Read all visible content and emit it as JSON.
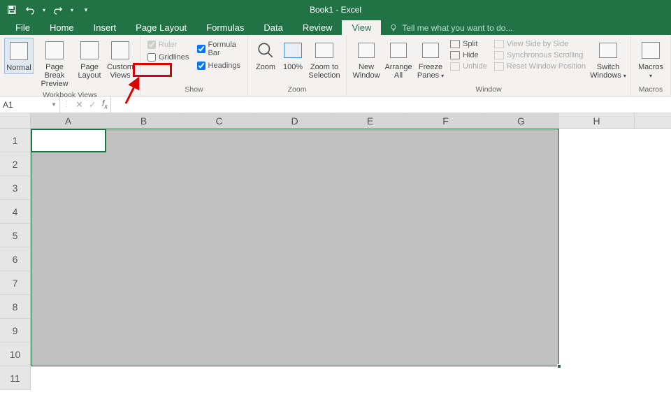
{
  "title": "Book1 - Excel",
  "menu": {
    "tabs": [
      "File",
      "Home",
      "Insert",
      "Page Layout",
      "Formulas",
      "Data",
      "Review",
      "View"
    ],
    "active": "View",
    "tellme": "Tell me what you want to do..."
  },
  "ribbon": {
    "workbook_views": {
      "normal": "Normal",
      "page_break": "Page Break Preview",
      "page_layout": "Page Layout",
      "custom_views": "Custom Views",
      "label": "Workbook Views"
    },
    "show": {
      "ruler": "Ruler",
      "gridlines": "Gridlines",
      "formula_bar": "Formula Bar",
      "headings": "Headings",
      "label": "Show"
    },
    "zoom": {
      "zoom": "Zoom",
      "hundred": "100%",
      "to_selection": "Zoom to Selection",
      "label": "Zoom"
    },
    "window": {
      "new_window": "New Window",
      "arrange_all": "Arrange All",
      "freeze_panes": "Freeze Panes",
      "split": "Split",
      "hide": "Hide",
      "unhide": "Unhide",
      "side_by_side": "View Side by Side",
      "sync_scroll": "Synchronous Scrolling",
      "reset_pos": "Reset Window Position",
      "switch_windows": "Switch Windows",
      "label": "Window"
    },
    "macros": {
      "macros": "Macros",
      "label": "Macros"
    }
  },
  "namebox": "A1",
  "columns": [
    "A",
    "B",
    "C",
    "D",
    "E",
    "F",
    "G",
    "H"
  ],
  "rows": [
    "1",
    "2",
    "3",
    "4",
    "5",
    "6",
    "7",
    "8",
    "9",
    "10",
    "11"
  ],
  "selection": {
    "from": "A1",
    "to": "G10",
    "active": "A1"
  }
}
